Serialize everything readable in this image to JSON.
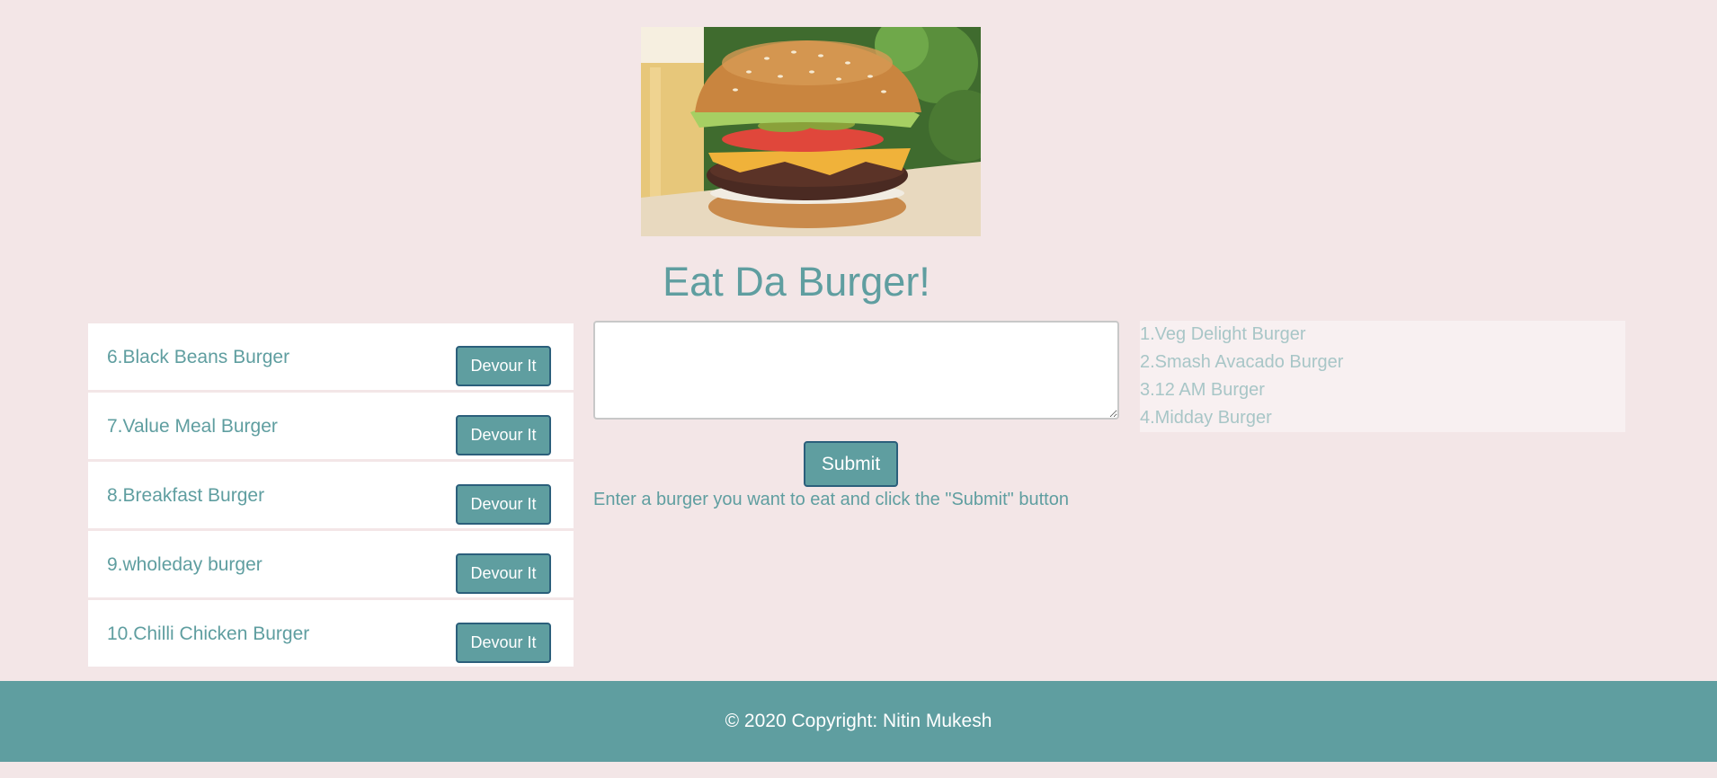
{
  "header": {
    "title": "Eat Da Burger!"
  },
  "hero_image": {
    "icon": "burger-photo"
  },
  "left_list": {
    "items": [
      {
        "name": "6.Black Beans Burger",
        "button_label": "Devour It"
      },
      {
        "name": "7.Value Meal Burger",
        "button_label": "Devour It"
      },
      {
        "name": "8.Breakfast Burger",
        "button_label": "Devour It"
      },
      {
        "name": "9.wholeday burger",
        "button_label": "Devour It"
      },
      {
        "name": "10.Chilli Chicken Burger",
        "button_label": "Devour It"
      }
    ]
  },
  "form": {
    "textarea_value": "",
    "submit_label": "Submit",
    "hint": "Enter a burger you want to eat and click the \"Submit\" button"
  },
  "right_list": {
    "items": [
      "1.Veg Delight Burger",
      "2.Smash Avacado Burger",
      "3.12 AM Burger",
      "4.Midday Burger"
    ]
  },
  "footer": {
    "text": "© 2020 Copyright: Nitin Mukesh"
  },
  "colors": {
    "accent": "#5f9ea0",
    "background": "#f3e6e7",
    "button_border": "#2b5f7b"
  }
}
